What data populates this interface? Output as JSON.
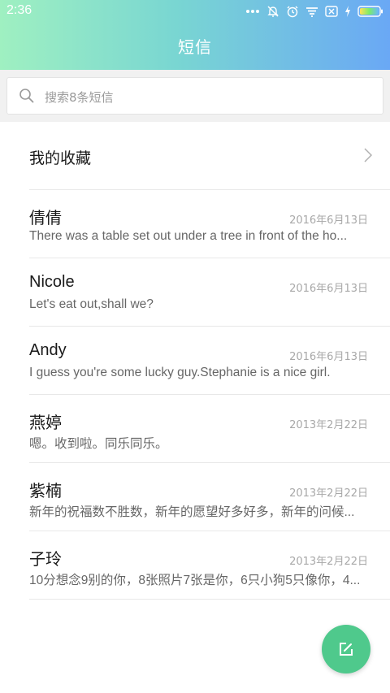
{
  "status_bar": {
    "time": "2:36",
    "icons": [
      "more-dots-icon",
      "mute-icon",
      "alarm-icon",
      "wifi-icon",
      "sim-icon",
      "charging-icon",
      "battery-icon"
    ]
  },
  "header": {
    "title": "短信"
  },
  "search": {
    "placeholder": "搜索8条短信"
  },
  "favorites": {
    "label": "我的收藏"
  },
  "messages": [
    {
      "name": "倩倩",
      "date": "2016年6月13日",
      "preview": "There was a table set out under a tree in front of the ho..."
    },
    {
      "name": "Nicole",
      "date": "2016年6月13日",
      "preview": "Let's eat out,shall we?"
    },
    {
      "name": "Andy",
      "date": "2016年6月13日",
      "preview": "I guess you're some lucky guy.Stephanie is a nice girl."
    },
    {
      "name": "燕婷",
      "date": "2013年2月22日",
      "preview": "嗯。收到啦。同乐同乐。"
    },
    {
      "name": "紫楠",
      "date": "2013年2月22日",
      "preview": "新年的祝福数不胜数，新年的愿望好多好多，新年的问候..."
    },
    {
      "name": "子玲",
      "date": "2013年2月22日",
      "preview": "10分想念9别的你，8张照片7张是你，6只小狗5只像你，4..."
    }
  ],
  "fab": {
    "icon": "compose-icon"
  },
  "colors": {
    "accent": "#4fc98c",
    "header_start": "#9ff0c1",
    "header_end": "#6aa8f5"
  }
}
